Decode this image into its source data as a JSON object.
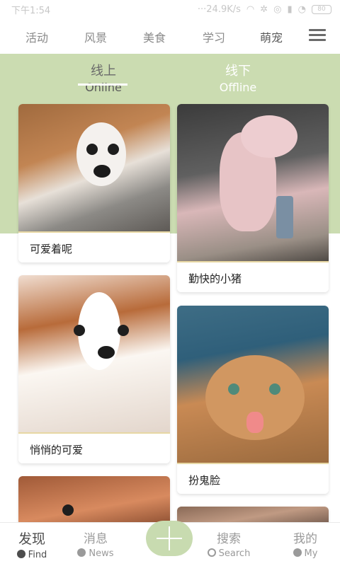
{
  "status_bar": {
    "time": "下午1:54",
    "network_speed": "···24.9K/s",
    "battery": "80"
  },
  "top_tabs": [
    {
      "label": "活动"
    },
    {
      "label": "风景"
    },
    {
      "label": "美食"
    },
    {
      "label": "学习"
    },
    {
      "label": "萌宠",
      "active": true
    }
  ],
  "mode_switch": {
    "online_cn": "线上",
    "online_en": "Online",
    "offline_cn": "线下",
    "offline_en": "Offline"
  },
  "cards": [
    {
      "caption": "可爱着呢"
    },
    {
      "caption": "勤快的小猪"
    },
    {
      "caption": "悄悄的可爱"
    },
    {
      "caption": "扮鬼脸"
    }
  ],
  "bottom_nav": {
    "find_cn": "发现",
    "find_en": "Find",
    "news_cn": "消息",
    "news_en": "News",
    "search_cn": "搜索",
    "search_en": "Search",
    "my_cn": "我的",
    "my_en": "My"
  },
  "colors": {
    "accent_green": "#cbdcb1",
    "plus_button": "#c8dbb0",
    "caption_border": "#e7d7a3"
  },
  "icons": {
    "menu": "menu-icon",
    "add": "plus-icon",
    "find": "heart-icon",
    "news": "chat-icon",
    "search": "search-icon",
    "my": "user-icon"
  }
}
